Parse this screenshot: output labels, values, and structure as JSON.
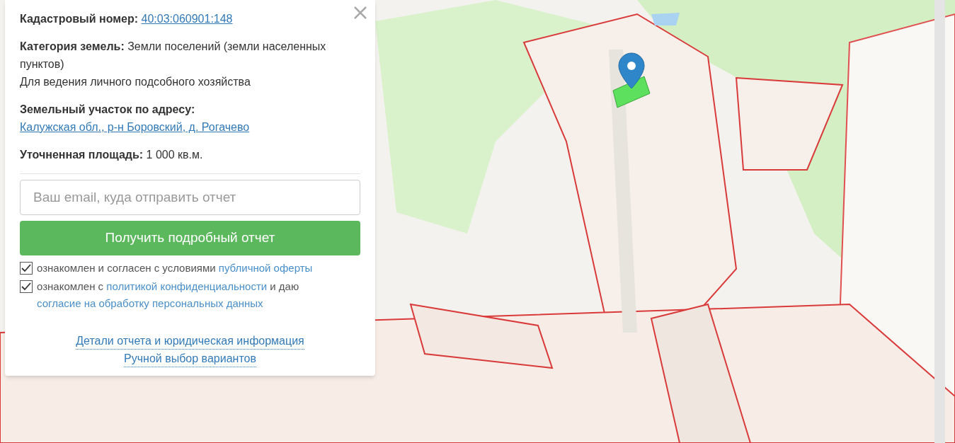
{
  "popup": {
    "fields": [
      {
        "label": "Кадастровый номер:",
        "value": "40:03:060901:148",
        "kind": "link"
      },
      {
        "label": "Категория земель:",
        "value": "Земли поселений (земли населенных пунктов)",
        "note": "Для ведения личного подсобного хозяйства",
        "kind": "text"
      },
      {
        "label": "Земельный участок по адресу:",
        "value": "Калужская обл., р-н Боровский, д. Рогачево",
        "kind": "link"
      },
      {
        "label": "Уточненная площадь:",
        "value": "1 000 кв.м.",
        "kind": "text"
      }
    ],
    "email": {
      "placeholder": "Ваш email, куда отправить отчет"
    },
    "submit": "Получить подробный отчет",
    "consents": [
      {
        "checked": true,
        "parts": [
          {
            "text": "ознакомлен и согласен с условиями ",
            "kind": "text"
          },
          {
            "text": "публичной оферты",
            "kind": "link"
          }
        ]
      },
      {
        "checked": true,
        "parts": [
          {
            "text": "ознакомлен с ",
            "kind": "text"
          },
          {
            "text": "политикой конфиденциальности",
            "kind": "link"
          },
          {
            "text": " и даю ",
            "kind": "text"
          },
          {
            "text": "согласие на обработку персональных данных",
            "kind": "link"
          }
        ]
      }
    ],
    "links": [
      "Детали отчета и юридическая информация",
      "Ручной выбор вариантов"
    ]
  }
}
